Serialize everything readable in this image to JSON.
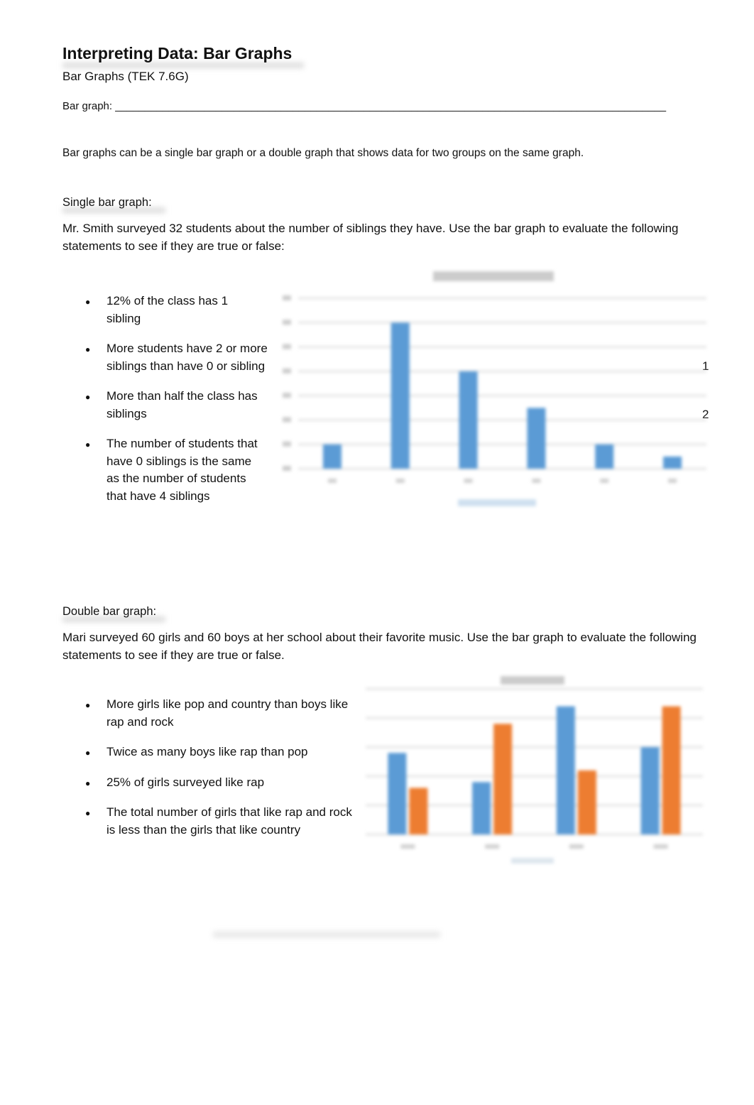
{
  "title": "Interpreting Data: Bar Graphs",
  "subtitle": "Bar Graphs (TEK 7.6G)",
  "definition": {
    "label": "Bar graph:",
    "blank": "_____________________________________________________________________________________________"
  },
  "intro": "Bar graphs can be a single bar graph or a double graph that shows data for two groups on the same graph.",
  "single": {
    "heading": "Single bar graph:",
    "prompt": "Mr. Smith surveyed 32 students about the number of siblings they have. Use the bar graph to evaluate the following statements to see if they are true or false:",
    "statements": [
      "12% of the class has 1 sibling",
      "More students have 2 or more siblings than have 0 or sibling",
      "More than half the class has siblings",
      "The number of students that have 0 siblings is the same as the number of students that have 4 siblings"
    ],
    "stray_marks": [
      "1",
      "2"
    ]
  },
  "double": {
    "heading": "Double bar graph:",
    "prompt": "Mari surveyed 60 girls and 60 boys at her school about their favorite music. Use the bar graph to evaluate the following statements to see if they are true or false.",
    "statements": [
      "More girls like pop and country than boys like rap and rock",
      "Twice as many boys like rap than pop",
      "25% of girls surveyed like rap",
      "The total number of girls that like rap and rock is less than the girls that like country"
    ]
  },
  "chart_data": [
    {
      "type": "bar",
      "values": [
        2,
        12,
        8,
        5,
        2,
        1
      ],
      "ylim": [
        0,
        14
      ],
      "grid": true,
      "color": "#5b9bd5",
      "legend": "bottom"
    },
    {
      "type": "bar",
      "series": [
        {
          "values": [
            14,
            9,
            22,
            15
          ],
          "color": "#5b9bd5"
        },
        {
          "values": [
            8,
            19,
            11,
            22
          ],
          "color": "#ed7d31"
        }
      ],
      "ylim": [
        0,
        25
      ],
      "grid": true,
      "legend": "bottom"
    }
  ]
}
